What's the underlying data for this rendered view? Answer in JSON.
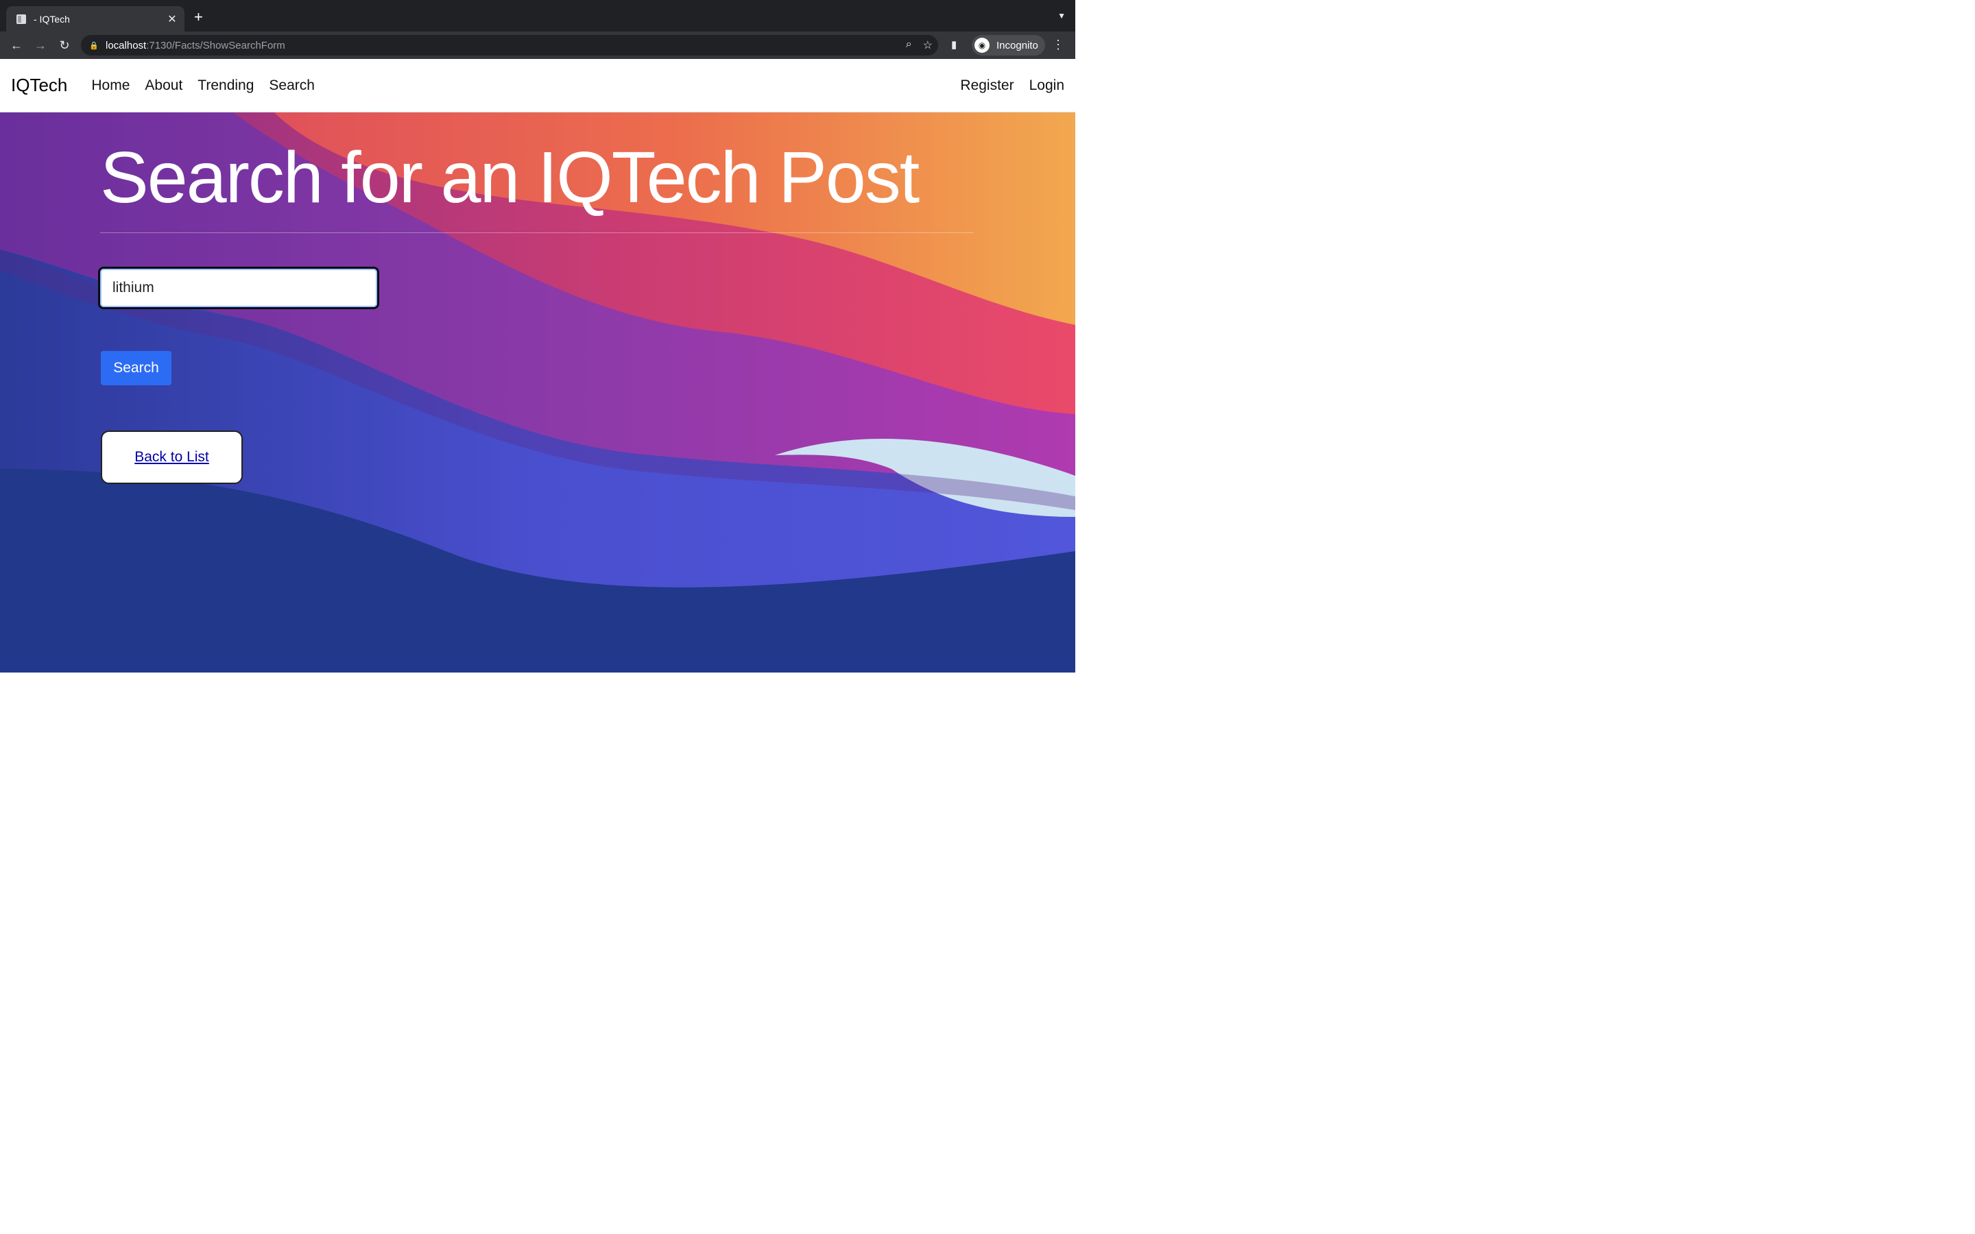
{
  "browser": {
    "tab_title": "- IQTech",
    "new_tab": "+",
    "url_host": "localhost",
    "url_path": ":7130/Facts/ShowSearchForm",
    "profile_label": "Incognito",
    "icons": [
      "back-icon",
      "forward-icon",
      "reload-icon",
      "lock-icon",
      "zoom-icon",
      "star-icon",
      "side-panel-icon",
      "incognito-icon",
      "menu-icon"
    ]
  },
  "nav": {
    "brand": "IQTech",
    "links": [
      "Home",
      "About",
      "Trending",
      "Search"
    ],
    "right": [
      "Register",
      "Login"
    ]
  },
  "page": {
    "heading": "Search for an IQTech Post",
    "search_value": "lithium",
    "search_button": "Search",
    "back_link": "Back to List"
  }
}
